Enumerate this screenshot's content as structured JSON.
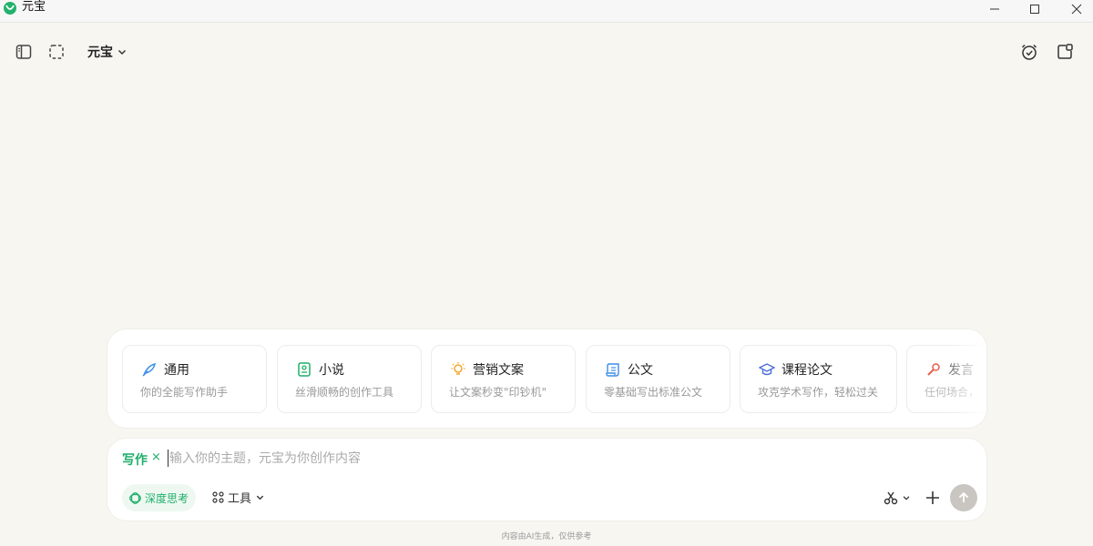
{
  "window": {
    "title": "元宝"
  },
  "header": {
    "model_label": "元宝"
  },
  "cards": [
    {
      "title": "通用",
      "desc": "你的全能写作助手",
      "icon": "quill-icon",
      "color": "#3b8ee8"
    },
    {
      "title": "小说",
      "desc": "丝滑顺畅的创作工具",
      "icon": "book-icon",
      "color": "#1fae6a"
    },
    {
      "title": "营销文案",
      "desc": "让文案秒变\"印钞机\"",
      "icon": "lightbulb-icon",
      "color": "#f2a72c"
    },
    {
      "title": "公文",
      "desc": "零基础写出标准公文",
      "icon": "scroll-icon",
      "color": "#3b8ee8"
    },
    {
      "title": "课程论文",
      "desc": "攻克学术写作，轻松过关",
      "icon": "graduation-cap-icon",
      "color": "#4a6fd6"
    },
    {
      "title": "发言",
      "desc": "任何场合，",
      "icon": "microphone-icon",
      "color": "#e8604c"
    }
  ],
  "input": {
    "mode_label": "写作",
    "mode_close": "×",
    "placeholder": "输入你的主题，元宝为你创作内容",
    "value": ""
  },
  "actions": {
    "deep_think_label": "深度思考",
    "tools_label": "工具"
  },
  "footer": {
    "disclaimer": "内容由AI生成，仅供参考"
  },
  "colors": {
    "accent": "#1fae6a",
    "background": "#f7f6f1",
    "send_disabled": "#c9c6c1"
  }
}
